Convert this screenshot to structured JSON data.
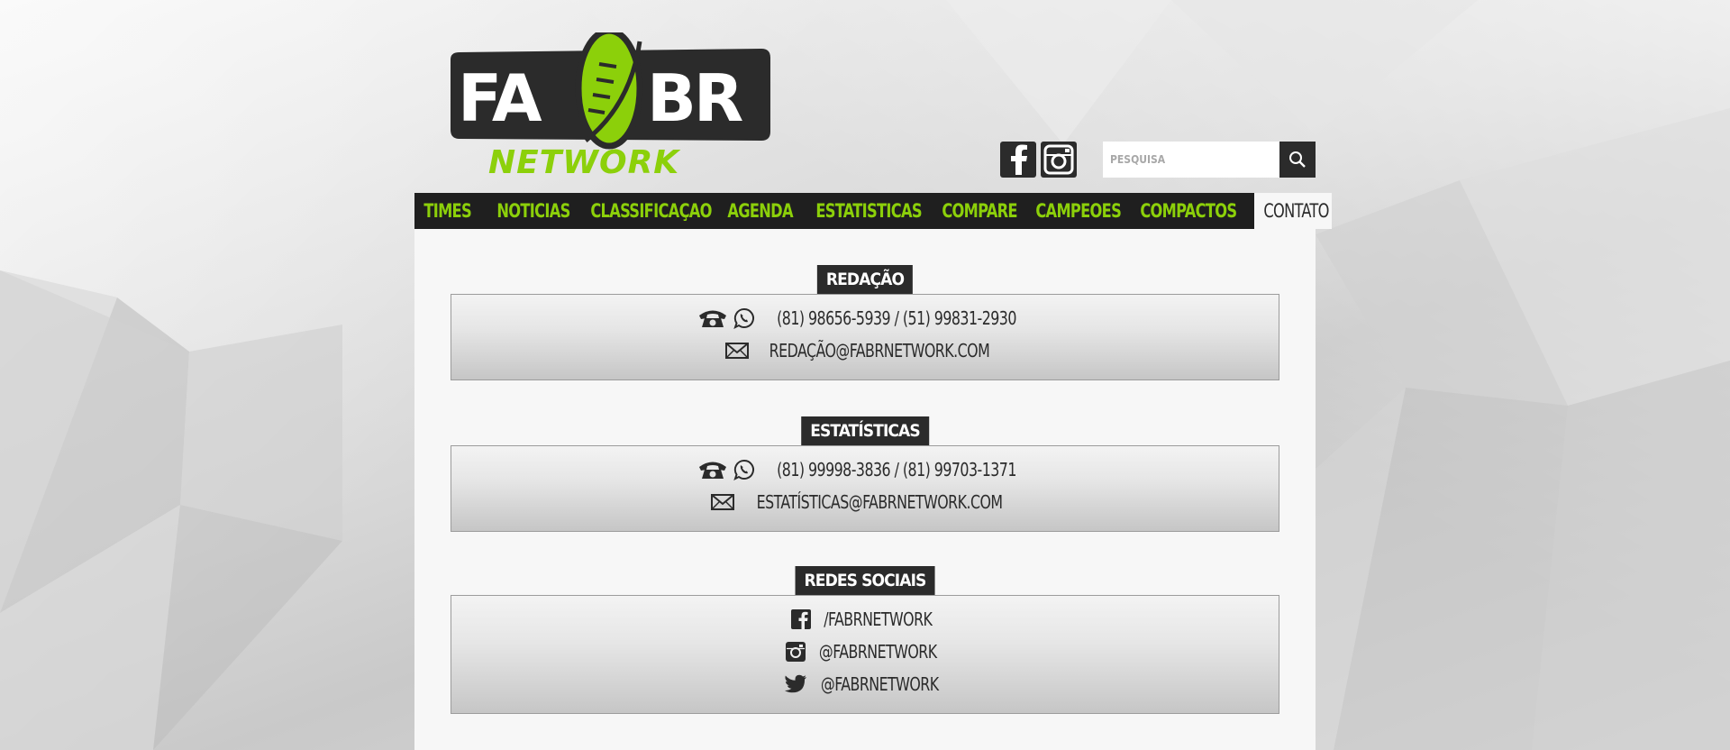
{
  "brand": {
    "logo_top": "FABR",
    "logo_bottom": "NETWORK",
    "colors": {
      "accent": "#8cd00a",
      "dark": "#2b2b2b",
      "nav_bg": "#1f1f1f"
    }
  },
  "header": {
    "social_icons": [
      "facebook-icon",
      "instagram-icon"
    ],
    "search": {
      "placeholder": "PESQUISA",
      "icon": "search-icon"
    }
  },
  "nav": {
    "items": [
      {
        "label": "TIMES"
      },
      {
        "label": "NOTICIAS"
      },
      {
        "label": "CLASSIFICAÇAO"
      },
      {
        "label": "AGENDA"
      },
      {
        "label": "ESTATISTICAS"
      },
      {
        "label": "COMPARE"
      },
      {
        "label": "CAMPEOES"
      },
      {
        "label": "COMPACTOS"
      },
      {
        "label": "CONTATO"
      }
    ],
    "active": "CONTATO"
  },
  "sections": {
    "redacao": {
      "title": "REDAÇÃO",
      "phones": "(81) 98656-5939 / (51) 99831-2930",
      "email": "REDAÇÃO@FABRNETWORK.COM"
    },
    "estatisticas": {
      "title": "ESTATÍSTICAS",
      "phones": "(81) 99998-3836 / (81) 99703-1371",
      "email": "ESTATÍSTICAS@FABRNETWORK.COM"
    },
    "redes": {
      "title": "REDES SOCIAIS",
      "facebook": "/FABRNETWORK",
      "instagram": "@FABRNETWORK",
      "twitter": "@FABRNETWORK"
    }
  }
}
